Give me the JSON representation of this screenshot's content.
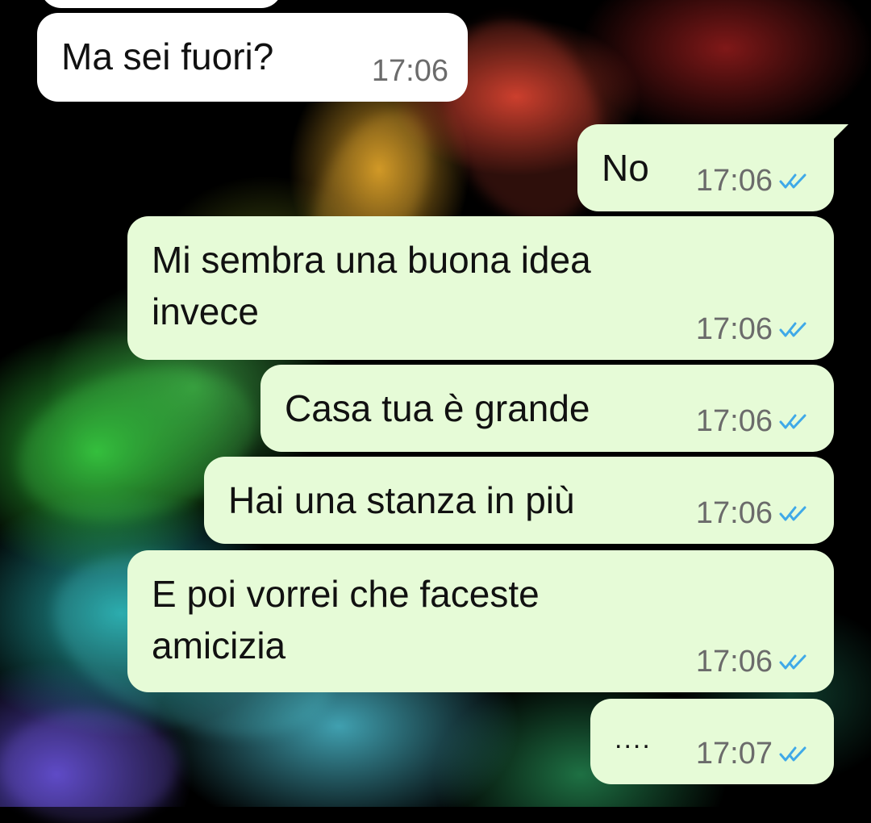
{
  "colors": {
    "incoming_bubble": "#ffffff",
    "outgoing_bubble": "#e6fbd7",
    "timestamp": "#6b6b6b",
    "read_receipt": "#3fa9e8"
  },
  "messages": [
    {
      "direction": "in",
      "text": "Ma sei fuori?",
      "time": "17:06"
    },
    {
      "direction": "out",
      "text": "No",
      "time": "17:06",
      "status": "read-double-check-icon"
    },
    {
      "direction": "out",
      "text": "Mi sembra una buona idea\ninvece",
      "time": "17:06",
      "status": "read-double-check-icon"
    },
    {
      "direction": "out",
      "text": "Casa tua è grande",
      "time": "17:06",
      "status": "read-double-check-icon"
    },
    {
      "direction": "out",
      "text": "Hai una stanza in più",
      "time": "17:06",
      "status": "read-double-check-icon"
    },
    {
      "direction": "out",
      "text": "E poi vorrei che faceste\namicizia",
      "time": "17:06",
      "status": "read-double-check-icon"
    },
    {
      "direction": "out",
      "text": "....",
      "time": "17:07",
      "status": "read-double-check-icon"
    }
  ]
}
